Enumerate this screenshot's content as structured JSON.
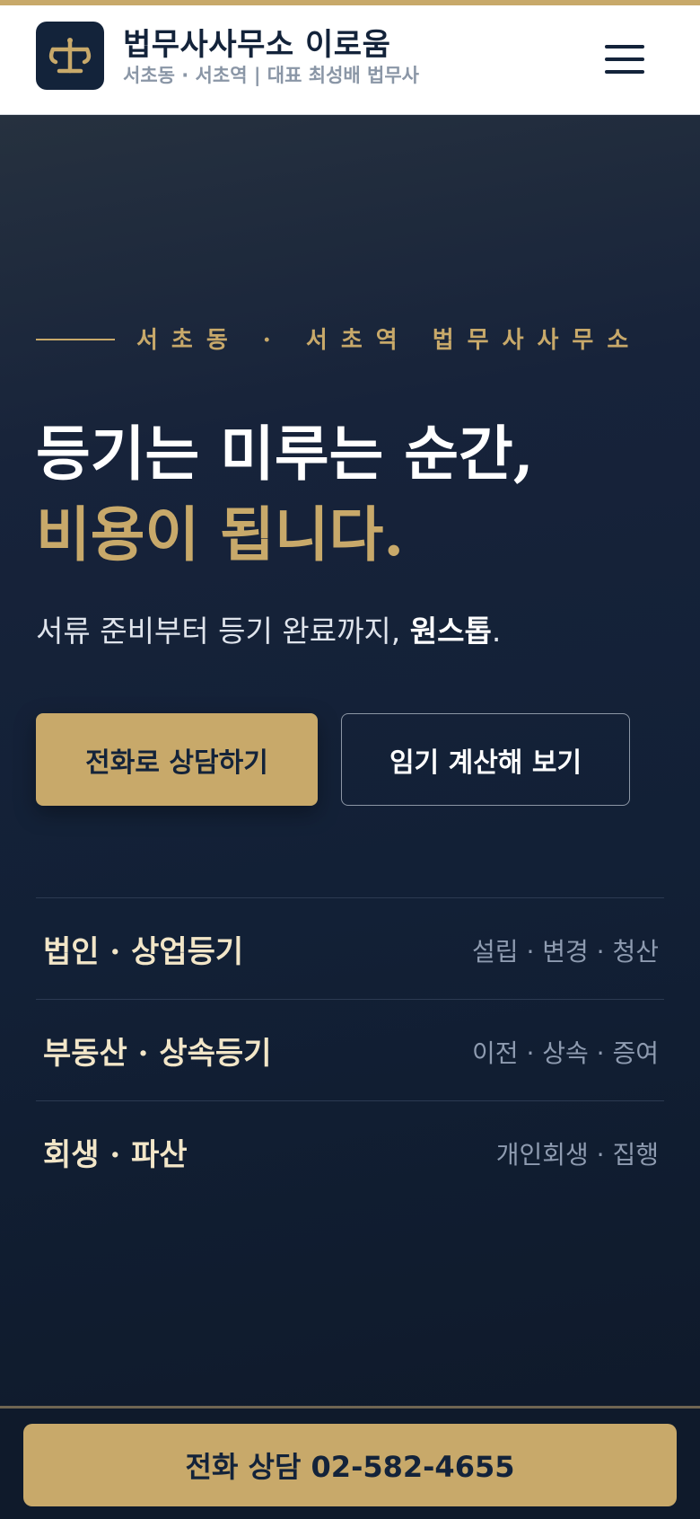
{
  "colors": {
    "accent_gold": "#c8a96a",
    "navy": "#13233a",
    "hero_bg": "#0f1a2b"
  },
  "header": {
    "brand_name": "법무사사무소 이로움",
    "brand_sub": "서초동 · 서초역 | 대표 최성배 법무사",
    "logo_icon": "scales-icon",
    "menu_icon": "hamburger-menu-icon"
  },
  "hero": {
    "eyebrow": "서초동 · 서초역 법무사사무소",
    "headline_line1": "등기는 미루는 순간,",
    "headline_line2": "비용이 됩니다.",
    "subcopy_prefix": "서류 준비부터 등기 완료까지, ",
    "subcopy_emphasis": "원스톱",
    "subcopy_suffix": ".",
    "primary_button": "전화로 상담하기",
    "secondary_button": "임기 계산해 보기"
  },
  "services": [
    {
      "title": "법인 · 상업등기",
      "tags": "설립 · 변경 · 청산"
    },
    {
      "title": "부동산 · 상속등기",
      "tags": "이전 · 상속 · 증여"
    },
    {
      "title": "회생 · 파산",
      "tags": "개인회생 · 집행"
    }
  ],
  "bottom_bar": {
    "cta_label": "전화 상담 02-582-4655"
  }
}
